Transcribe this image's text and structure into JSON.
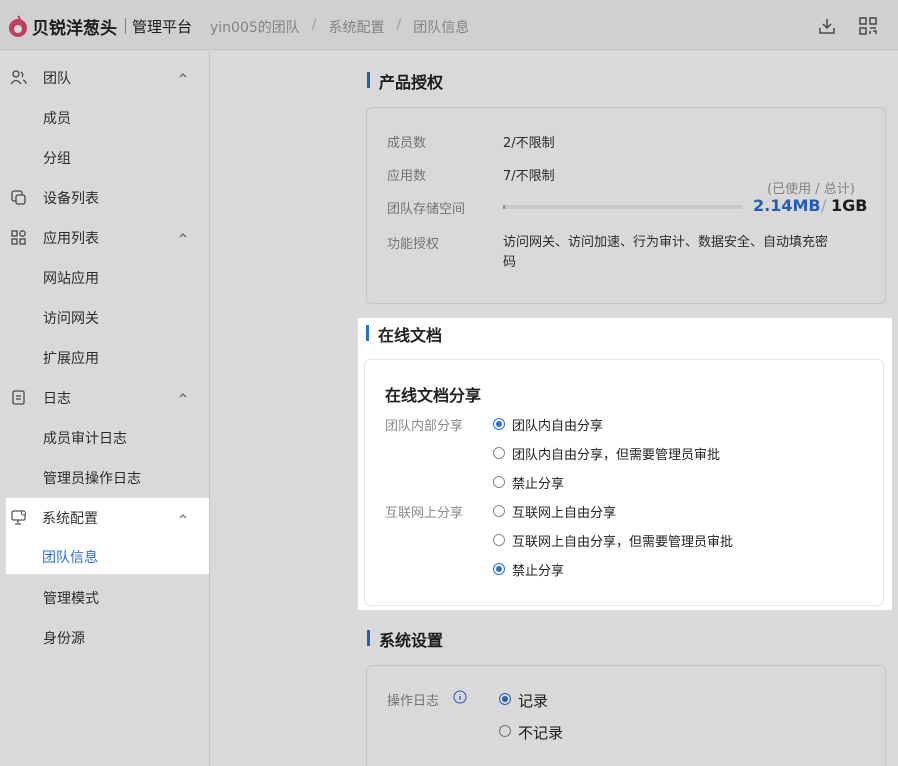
{
  "header": {
    "brand": "贝锐洋葱头",
    "platform": "管理平台",
    "breadcrumb": [
      "yin005的团队",
      "系统配置",
      "团队信息"
    ]
  },
  "sidebar": {
    "items": [
      {
        "label": "团队",
        "icon": "team-icon",
        "expanded": true
      },
      {
        "label": "成员"
      },
      {
        "label": "分组"
      },
      {
        "label": "设备列表",
        "icon": "device-icon"
      },
      {
        "label": "应用列表",
        "icon": "apps-icon",
        "expanded": true
      },
      {
        "label": "网站应用"
      },
      {
        "label": "访问网关"
      },
      {
        "label": "扩展应用"
      },
      {
        "label": "日志",
        "icon": "log-icon",
        "expanded": true
      },
      {
        "label": "成员审计日志"
      },
      {
        "label": "管理员操作日志"
      },
      {
        "label": "系统配置",
        "icon": "monitor-settings-icon",
        "expanded": true
      },
      {
        "label": "团队信息",
        "active": true
      },
      {
        "label": "管理模式"
      },
      {
        "label": "身份源"
      }
    ]
  },
  "license": {
    "title": "产品授权",
    "members_label": "成员数",
    "members_value": "2/不限制",
    "apps_label": "应用数",
    "apps_value": "7/不限制",
    "storage_label": "团队存储空间",
    "storage_caption_used": "已使用",
    "storage_caption_total": "总计",
    "storage_used": "2.14MB",
    "storage_total": "1GB",
    "storage_fraction": 0.002,
    "features_label": "功能授权",
    "features_value_line1": "访问网关、访问加速、行为审计、数据安全、自动填充密",
    "features_value_line2": "码"
  },
  "docs": {
    "title": "在线文档",
    "card_title": "在线文档分享",
    "internal_label": "团队内部分享",
    "internal_options": [
      "团队内自由分享",
      "团队内自由分享，但需要管理员审批",
      "禁止分享"
    ],
    "internal_selected": 0,
    "internet_label": "互联网上分享",
    "internet_options": [
      "互联网上自由分享",
      "互联网上自由分享，但需要管理员审批",
      "禁止分享"
    ],
    "internet_selected": 2
  },
  "system": {
    "title": "系统设置",
    "oplog_label": "操作日志",
    "oplog_options": [
      "记录",
      "不记录"
    ],
    "oplog_selected": 0
  },
  "colors": {
    "accent": "#2b6fd6",
    "logo": "#e04b6a"
  }
}
